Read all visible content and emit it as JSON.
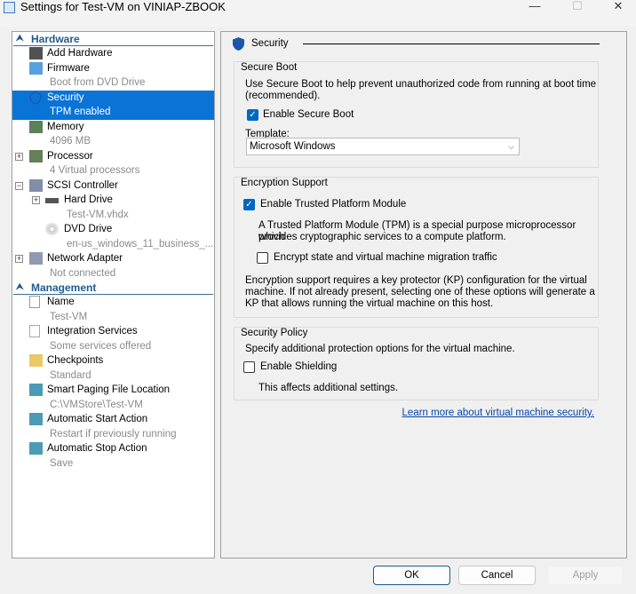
{
  "window": {
    "title": "Settings for Test-VM on VINIAP-ZBOOK",
    "minimize": "—",
    "maximize": "☐",
    "close": "✕"
  },
  "tree": {
    "hardware_label": "Hardware",
    "management_label": "Management",
    "hardware": [
      {
        "label": "Add Hardware",
        "icon": "add-hardware-icon"
      },
      {
        "label": "Firmware",
        "sub": "Boot from DVD Drive",
        "icon": "firmware-icon"
      },
      {
        "label": "Security",
        "sub": "TPM enabled",
        "icon": "shield-icon",
        "selected": true
      },
      {
        "label": "Memory",
        "sub": "4096 MB",
        "icon": "memory-icon"
      },
      {
        "label": "Processor",
        "sub": "4 Virtual processors",
        "icon": "processor-icon",
        "expander": "+"
      },
      {
        "label": "SCSI Controller",
        "icon": "scsi-controller-icon",
        "expander": "−"
      },
      {
        "label": "Hard Drive",
        "sub": "Test-VM.vhdx",
        "icon": "hard-drive-icon",
        "expander": "+"
      },
      {
        "label": "DVD Drive",
        "sub": "en-us_windows_11_business_...",
        "icon": "dvd-drive-icon"
      },
      {
        "label": "Network Adapter",
        "sub": "Not connected",
        "icon": "network-adapter-icon",
        "expander": "+"
      }
    ],
    "management": [
      {
        "label": "Name",
        "sub": "Test-VM",
        "icon": "name-icon"
      },
      {
        "label": "Integration Services",
        "sub": "Some services offered",
        "icon": "integration-services-icon"
      },
      {
        "label": "Checkpoints",
        "sub": "Standard",
        "icon": "checkpoints-icon"
      },
      {
        "label": "Smart Paging File Location",
        "sub": "C:\\VMStore\\Test-VM",
        "icon": "smart-paging-icon"
      },
      {
        "label": "Automatic Start Action",
        "sub": "Restart if previously running",
        "icon": "auto-start-icon"
      },
      {
        "label": "Automatic Stop Action",
        "sub": "Save",
        "icon": "auto-stop-icon"
      }
    ]
  },
  "security": {
    "heading": "Security",
    "secure_boot": {
      "title": "Secure Boot",
      "desc1": "Use Secure Boot to help prevent unauthorized code from running at boot time",
      "desc2": "(recommended).",
      "checkbox": "Enable Secure Boot",
      "checked": true,
      "template_label": "Template:",
      "template_value": "Microsoft Windows"
    },
    "encryption": {
      "title": "Encryption Support",
      "tpm_checkbox": "Enable Trusted Platform Module",
      "tpm_checked": true,
      "tpm_desc1": "A Trusted Platform Module (TPM) is a special purpose microprocessor which",
      "tpm_desc2": "provides cryptographic services to a compute platform.",
      "encrypt_checkbox": "Encrypt state and virtual machine migration traffic",
      "encrypt_checked": false,
      "kp1": "Encryption support requires a key protector (KP) configuration for the virtual",
      "kp2": "machine. If not already present, selecting one of these options will generate a",
      "kp3": "KP that allows running the virtual machine on this host."
    },
    "policy": {
      "title": "Security Policy",
      "desc": "Specify additional protection options for the virtual machine.",
      "checkbox": "Enable Shielding",
      "checked": false,
      "note": "This affects additional settings."
    },
    "learn_more": "Learn more about virtual machine security."
  },
  "buttons": {
    "ok": "OK",
    "cancel": "Cancel",
    "apply": "Apply"
  },
  "colors": {
    "selection": "#0a74d6",
    "group_header": "#1f5c8e",
    "link": "#0645ad"
  }
}
